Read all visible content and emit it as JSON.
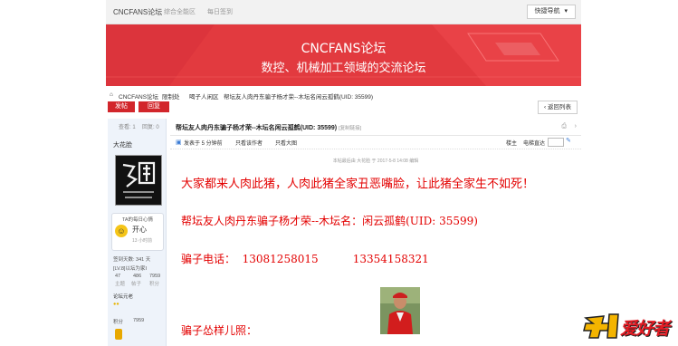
{
  "topbar": {
    "site_name": "CNCFANS论坛",
    "tabs": [
      "综合全能区",
      "每日签到"
    ],
    "quick_nav": "快捷导航"
  },
  "banner": {
    "title": "CNCFANS论坛",
    "subtitle": "数控、机械加工领域的交流论坛"
  },
  "breadcrumb": {
    "items": [
      "CNCFANS论坛",
      "限制处",
      "喝子人闲区",
      "帮坛友人肉丹东骗子杨才荣--木坛名闲云孤鹤(UID: 35599)"
    ]
  },
  "actions": {
    "post": "发帖",
    "reply": "回复",
    "back": "返回列表"
  },
  "user": {
    "stats_views": "查看: 1",
    "stats_replies": "回复: 0",
    "name": "大花脸",
    "mood_label": "TA的每日心情",
    "mood_value": "开心",
    "mood_time": "13 小时前",
    "signin_days": "签到天数: 341 天",
    "level": "[LV.8]以坛为家I",
    "counts": [
      "47",
      "486",
      "7959"
    ],
    "count_labels": [
      "主题",
      "帖子",
      "积分"
    ],
    "group_label": "论坛元老",
    "points_label": "积分",
    "points_value": "7959"
  },
  "post": {
    "title": "帮坛友人肉丹东骗子杨才荣--木坛名闲云孤鹤(UID: 35599)",
    "title_tag": "[复制链接]",
    "floor": "楼主",
    "author_line": "发表于 5 分钟前",
    "only_author": "只看该作者",
    "only_big": "只看大图",
    "big_font": "电梯直达",
    "edited_note": "本帖最后由 大花脸 于 2017-5-8 14:08 编辑",
    "lines": [
      "大家都来人肉此猪，人肉此猪全家丑恶嘴脸，让此猪全家生不如死！",
      "帮坛友人肉丹东骗子杨才荣--木坛名：闲云孤鹤(UID: 35599)",
      "骗子电话：  13081258015          13354158321",
      "骗子怂样儿照："
    ]
  },
  "watermark": "爱好者"
}
